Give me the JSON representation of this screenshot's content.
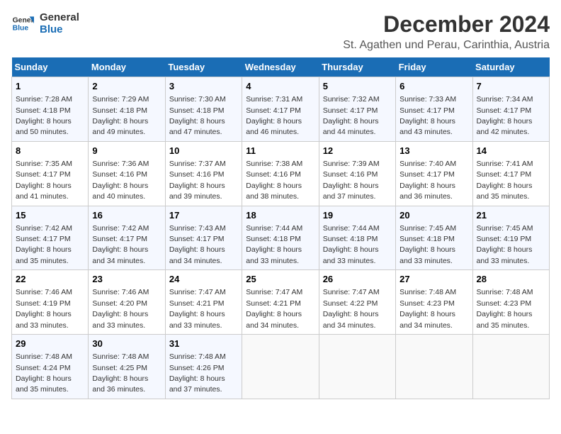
{
  "logo": {
    "line1": "General",
    "line2": "Blue"
  },
  "title": "December 2024",
  "subtitle": "St. Agathen und Perau, Carinthia, Austria",
  "days_header": [
    "Sunday",
    "Monday",
    "Tuesday",
    "Wednesday",
    "Thursday",
    "Friday",
    "Saturday"
  ],
  "weeks": [
    [
      {
        "day": "1",
        "detail": "Sunrise: 7:28 AM\nSunset: 4:18 PM\nDaylight: 8 hours\nand 50 minutes."
      },
      {
        "day": "2",
        "detail": "Sunrise: 7:29 AM\nSunset: 4:18 PM\nDaylight: 8 hours\nand 49 minutes."
      },
      {
        "day": "3",
        "detail": "Sunrise: 7:30 AM\nSunset: 4:18 PM\nDaylight: 8 hours\nand 47 minutes."
      },
      {
        "day": "4",
        "detail": "Sunrise: 7:31 AM\nSunset: 4:17 PM\nDaylight: 8 hours\nand 46 minutes."
      },
      {
        "day": "5",
        "detail": "Sunrise: 7:32 AM\nSunset: 4:17 PM\nDaylight: 8 hours\nand 44 minutes."
      },
      {
        "day": "6",
        "detail": "Sunrise: 7:33 AM\nSunset: 4:17 PM\nDaylight: 8 hours\nand 43 minutes."
      },
      {
        "day": "7",
        "detail": "Sunrise: 7:34 AM\nSunset: 4:17 PM\nDaylight: 8 hours\nand 42 minutes."
      }
    ],
    [
      {
        "day": "8",
        "detail": "Sunrise: 7:35 AM\nSunset: 4:17 PM\nDaylight: 8 hours\nand 41 minutes."
      },
      {
        "day": "9",
        "detail": "Sunrise: 7:36 AM\nSunset: 4:16 PM\nDaylight: 8 hours\nand 40 minutes."
      },
      {
        "day": "10",
        "detail": "Sunrise: 7:37 AM\nSunset: 4:16 PM\nDaylight: 8 hours\nand 39 minutes."
      },
      {
        "day": "11",
        "detail": "Sunrise: 7:38 AM\nSunset: 4:16 PM\nDaylight: 8 hours\nand 38 minutes."
      },
      {
        "day": "12",
        "detail": "Sunrise: 7:39 AM\nSunset: 4:16 PM\nDaylight: 8 hours\nand 37 minutes."
      },
      {
        "day": "13",
        "detail": "Sunrise: 7:40 AM\nSunset: 4:17 PM\nDaylight: 8 hours\nand 36 minutes."
      },
      {
        "day": "14",
        "detail": "Sunrise: 7:41 AM\nSunset: 4:17 PM\nDaylight: 8 hours\nand 35 minutes."
      }
    ],
    [
      {
        "day": "15",
        "detail": "Sunrise: 7:42 AM\nSunset: 4:17 PM\nDaylight: 8 hours\nand 35 minutes."
      },
      {
        "day": "16",
        "detail": "Sunrise: 7:42 AM\nSunset: 4:17 PM\nDaylight: 8 hours\nand 34 minutes."
      },
      {
        "day": "17",
        "detail": "Sunrise: 7:43 AM\nSunset: 4:17 PM\nDaylight: 8 hours\nand 34 minutes."
      },
      {
        "day": "18",
        "detail": "Sunrise: 7:44 AM\nSunset: 4:18 PM\nDaylight: 8 hours\nand 33 minutes."
      },
      {
        "day": "19",
        "detail": "Sunrise: 7:44 AM\nSunset: 4:18 PM\nDaylight: 8 hours\nand 33 minutes."
      },
      {
        "day": "20",
        "detail": "Sunrise: 7:45 AM\nSunset: 4:18 PM\nDaylight: 8 hours\nand 33 minutes."
      },
      {
        "day": "21",
        "detail": "Sunrise: 7:45 AM\nSunset: 4:19 PM\nDaylight: 8 hours\nand 33 minutes."
      }
    ],
    [
      {
        "day": "22",
        "detail": "Sunrise: 7:46 AM\nSunset: 4:19 PM\nDaylight: 8 hours\nand 33 minutes."
      },
      {
        "day": "23",
        "detail": "Sunrise: 7:46 AM\nSunset: 4:20 PM\nDaylight: 8 hours\nand 33 minutes."
      },
      {
        "day": "24",
        "detail": "Sunrise: 7:47 AM\nSunset: 4:21 PM\nDaylight: 8 hours\nand 33 minutes."
      },
      {
        "day": "25",
        "detail": "Sunrise: 7:47 AM\nSunset: 4:21 PM\nDaylight: 8 hours\nand 34 minutes."
      },
      {
        "day": "26",
        "detail": "Sunrise: 7:47 AM\nSunset: 4:22 PM\nDaylight: 8 hours\nand 34 minutes."
      },
      {
        "day": "27",
        "detail": "Sunrise: 7:48 AM\nSunset: 4:23 PM\nDaylight: 8 hours\nand 34 minutes."
      },
      {
        "day": "28",
        "detail": "Sunrise: 7:48 AM\nSunset: 4:23 PM\nDaylight: 8 hours\nand 35 minutes."
      }
    ],
    [
      {
        "day": "29",
        "detail": "Sunrise: 7:48 AM\nSunset: 4:24 PM\nDaylight: 8 hours\nand 35 minutes."
      },
      {
        "day": "30",
        "detail": "Sunrise: 7:48 AM\nSunset: 4:25 PM\nDaylight: 8 hours\nand 36 minutes."
      },
      {
        "day": "31",
        "detail": "Sunrise: 7:48 AM\nSunset: 4:26 PM\nDaylight: 8 hours\nand 37 minutes."
      },
      {
        "day": "",
        "detail": ""
      },
      {
        "day": "",
        "detail": ""
      },
      {
        "day": "",
        "detail": ""
      },
      {
        "day": "",
        "detail": ""
      }
    ]
  ]
}
